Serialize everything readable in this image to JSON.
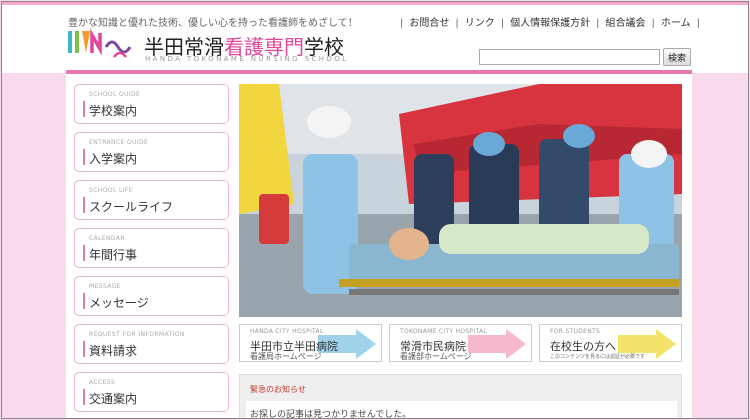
{
  "header": {
    "tagline": "豊かな知識と優れた技術、優しい心を持った看護師をめざして！",
    "school_name_pre": "半田常滑",
    "school_name_accent": "看護専門",
    "school_name_post": "学校",
    "school_name_en": "HANDA TOKONAME NURSING SCHOOL"
  },
  "topnav": {
    "items": [
      "お問合せ",
      "リンク",
      "個人情報保護方針",
      "組合議会",
      "ホーム"
    ]
  },
  "search": {
    "button_label": "検索",
    "value": ""
  },
  "sidebar": {
    "items": [
      {
        "en": "SCHOOL GUIDE",
        "ja": "学校案内"
      },
      {
        "en": "ENTRANCE GUIDE",
        "ja": "入学案内"
      },
      {
        "en": "SCHOOL LIFE",
        "ja": "スクールライフ"
      },
      {
        "en": "CALENDAR",
        "ja": "年間行事"
      },
      {
        "en": "MESSAGE",
        "ja": "メッセージ"
      },
      {
        "en": "REQUEST FOR INFORMATION",
        "ja": "資料請求"
      },
      {
        "en": "ACCESS",
        "ja": "交通案内"
      }
    ]
  },
  "banners": [
    {
      "en": "HANDA CITY HOSPITAL",
      "ja1": "半田市立半田病院",
      "ja2": "看護局ホームページ",
      "color": "#9fd3ec"
    },
    {
      "en": "TOKONAME CITY HOSPITAL",
      "ja1": "常滑市民病院",
      "ja2": "看護部ホームページ",
      "color": "#f6b7cf"
    },
    {
      "en": "FOR STUDENTS",
      "ja1": "在校生の方へ",
      "ja2": "このコンテンツを見るには認証が必要です",
      "color": "#f3e36b"
    }
  ],
  "notice": {
    "title": "緊急のお知らせ",
    "body": "お探しの記事は見つかりませんでした。"
  },
  "colors": {
    "accent": "#e0479a",
    "background": "#f9d9ec",
    "sidebar_border": "#f0b3d2"
  }
}
